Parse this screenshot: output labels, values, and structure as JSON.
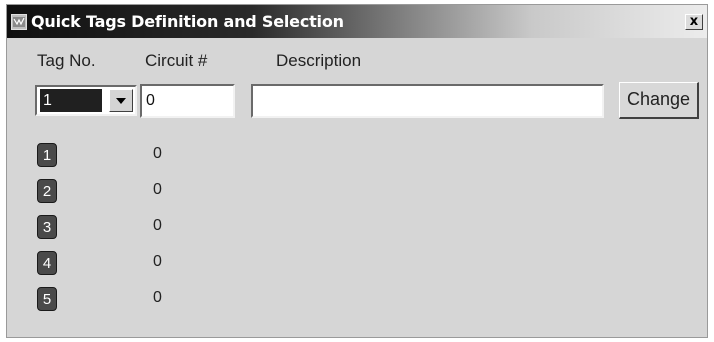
{
  "window": {
    "title": "Quick Tags Definition and Selection",
    "close_label": "x"
  },
  "headers": {
    "tag_no": "Tag No.",
    "circuit": "Circuit #",
    "description": "Description"
  },
  "form": {
    "tag_selected": "1",
    "circuit_value": "0",
    "description_value": "",
    "change_label": "Change"
  },
  "tags": [
    {
      "number": "1",
      "circuit": "0"
    },
    {
      "number": "2",
      "circuit": "0"
    },
    {
      "number": "3",
      "circuit": "0"
    },
    {
      "number": "4",
      "circuit": "0"
    },
    {
      "number": "5",
      "circuit": "0"
    }
  ]
}
